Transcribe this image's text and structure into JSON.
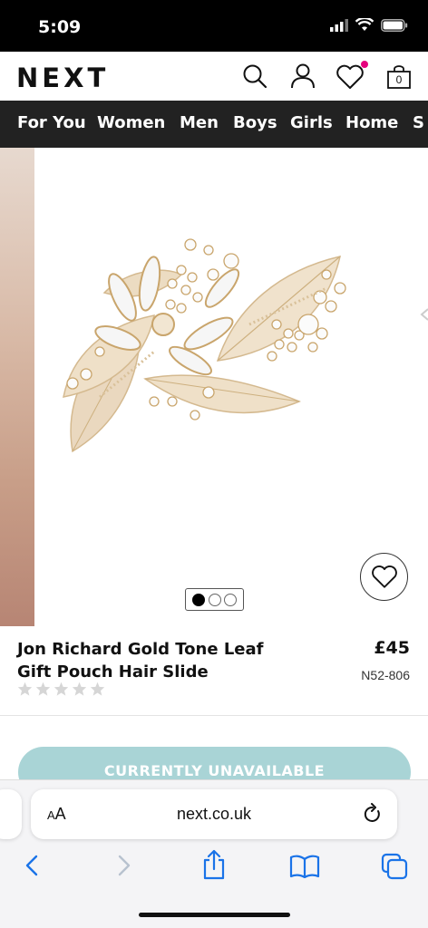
{
  "status": {
    "time": "5:09"
  },
  "header": {
    "logo": "NEXT",
    "bag_count": "0"
  },
  "nav": {
    "items": [
      "For You",
      "Women",
      "Men",
      "Boys",
      "Girls",
      "Home",
      "S"
    ]
  },
  "gallery": {
    "current_index": 1,
    "total": 3
  },
  "product": {
    "title_line1": "Jon Richard Gold Tone Leaf",
    "title_line2": "Gift Pouch Hair Slide",
    "price": "£45",
    "code": "N52-806",
    "rating": 0,
    "cta": "CURRENTLY UNAVAILABLE"
  },
  "browser": {
    "aa_label_small": "A",
    "aa_label_large": "A",
    "url": "next.co.uk"
  },
  "colors": {
    "nav_bg": "#222222",
    "cta_bg": "#a9d4d6",
    "wishlist_badge": "#e6007e",
    "ios_blue": "#1a73e8"
  }
}
